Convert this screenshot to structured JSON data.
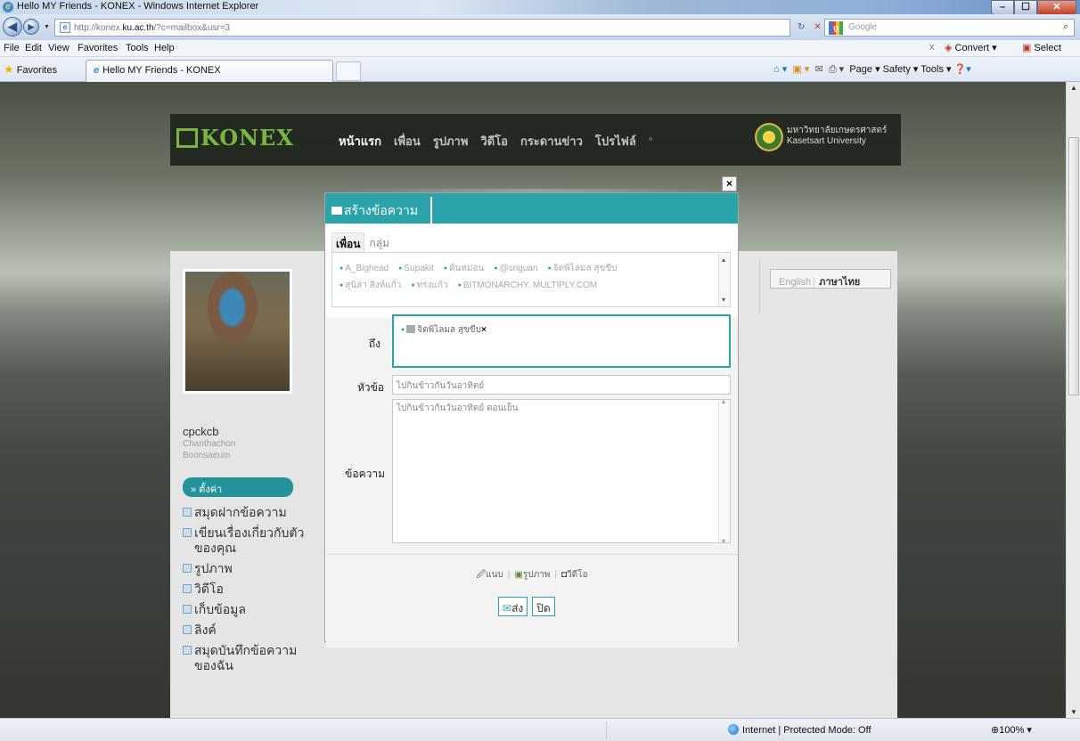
{
  "window": {
    "title": "Hello MY Friends - KONEX - Windows Internet Explorer",
    "min_glyph": "–",
    "max_glyph": "☐",
    "close_glyph": "✕"
  },
  "address": {
    "url_prefix": "http://konex.",
    "url_domain": "ku.ac.th",
    "url_suffix": "/?c=mailbox&usr=3",
    "refresh_glyph": "↻",
    "stop_glyph": "✕",
    "search_placeholder": "Google",
    "back_glyph": "◀",
    "forward_glyph": "▶"
  },
  "menu": {
    "items": [
      "File",
      "Edit",
      "View",
      "Favorites",
      "Tools",
      "Help"
    ],
    "right": {
      "close": "x",
      "convert": "Convert ▾",
      "select": "Select"
    }
  },
  "favbar": {
    "favorites_label": "Favorites",
    "tab_label": "Hello MY Friends - KONEX",
    "commands": "Page ▾  Safety ▾  Tools ▾"
  },
  "site": {
    "logo_text": "KONEX",
    "nav": [
      "หน้าแรก",
      "เพื่อน",
      "รูปภาพ",
      "วิดีโอ",
      "กระดานข่าว",
      "โปรไฟล์",
      "◦"
    ],
    "ku_line1": "มหาวิทยาลัยเกษตรศาสตร์",
    "ku_line2": "Kasetsart University"
  },
  "profile": {
    "username": "cpckcb",
    "realname_line1": "Chanthachon",
    "realname_line2": "Boonsaeum",
    "settings_btn": "» ตั้งค่า",
    "side_items": [
      "สมุดฝากข้อความ",
      "เขียนเรื่องเกี่ยวกับตัวของคุณ",
      "รูปภาพ",
      "วิดีโอ",
      "เก็บข้อมูล",
      "ลิงค์",
      "สมุดบันทึกข้อความของฉัน"
    ],
    "lang_english": "English",
    "lang_thai": "ภาษาไทย"
  },
  "modal": {
    "title": "สร้างข้อความ",
    "close_glyph": "×",
    "tab_friends": "เพื่อน",
    "tab_groups": "กลุ่ม",
    "friends": [
      "A_Bighead",
      "Supakit",
      "ต้นหม่อน",
      "@snguan",
      "จิตพิไลมล สุขขีบ",
      "สุนิสา สิงห์แก้ว",
      "ทรงแก้ว",
      "BITMONARCHY. MULTIPLY.COM"
    ],
    "to_label": "ถึง",
    "to_recipient": "จิตพิไลมล สุขขีบ",
    "subject_label": "หัวข้อ",
    "subject_value": "ไปกินข้าวกันวันอาทิตย์",
    "message_label": "ข้อความ",
    "message_value": "ไปกินข้าวกันวันอาทิตย์ ตอนเย็น",
    "attach_file": "แนบ",
    "attach_photo": "รูปภาพ",
    "attach_video": "วีดีโอ",
    "send_btn": "ส่ง",
    "close_btn": "ปิด"
  },
  "status": {
    "zone": "Internet | Protected Mode: Off",
    "zoom": "100%"
  }
}
